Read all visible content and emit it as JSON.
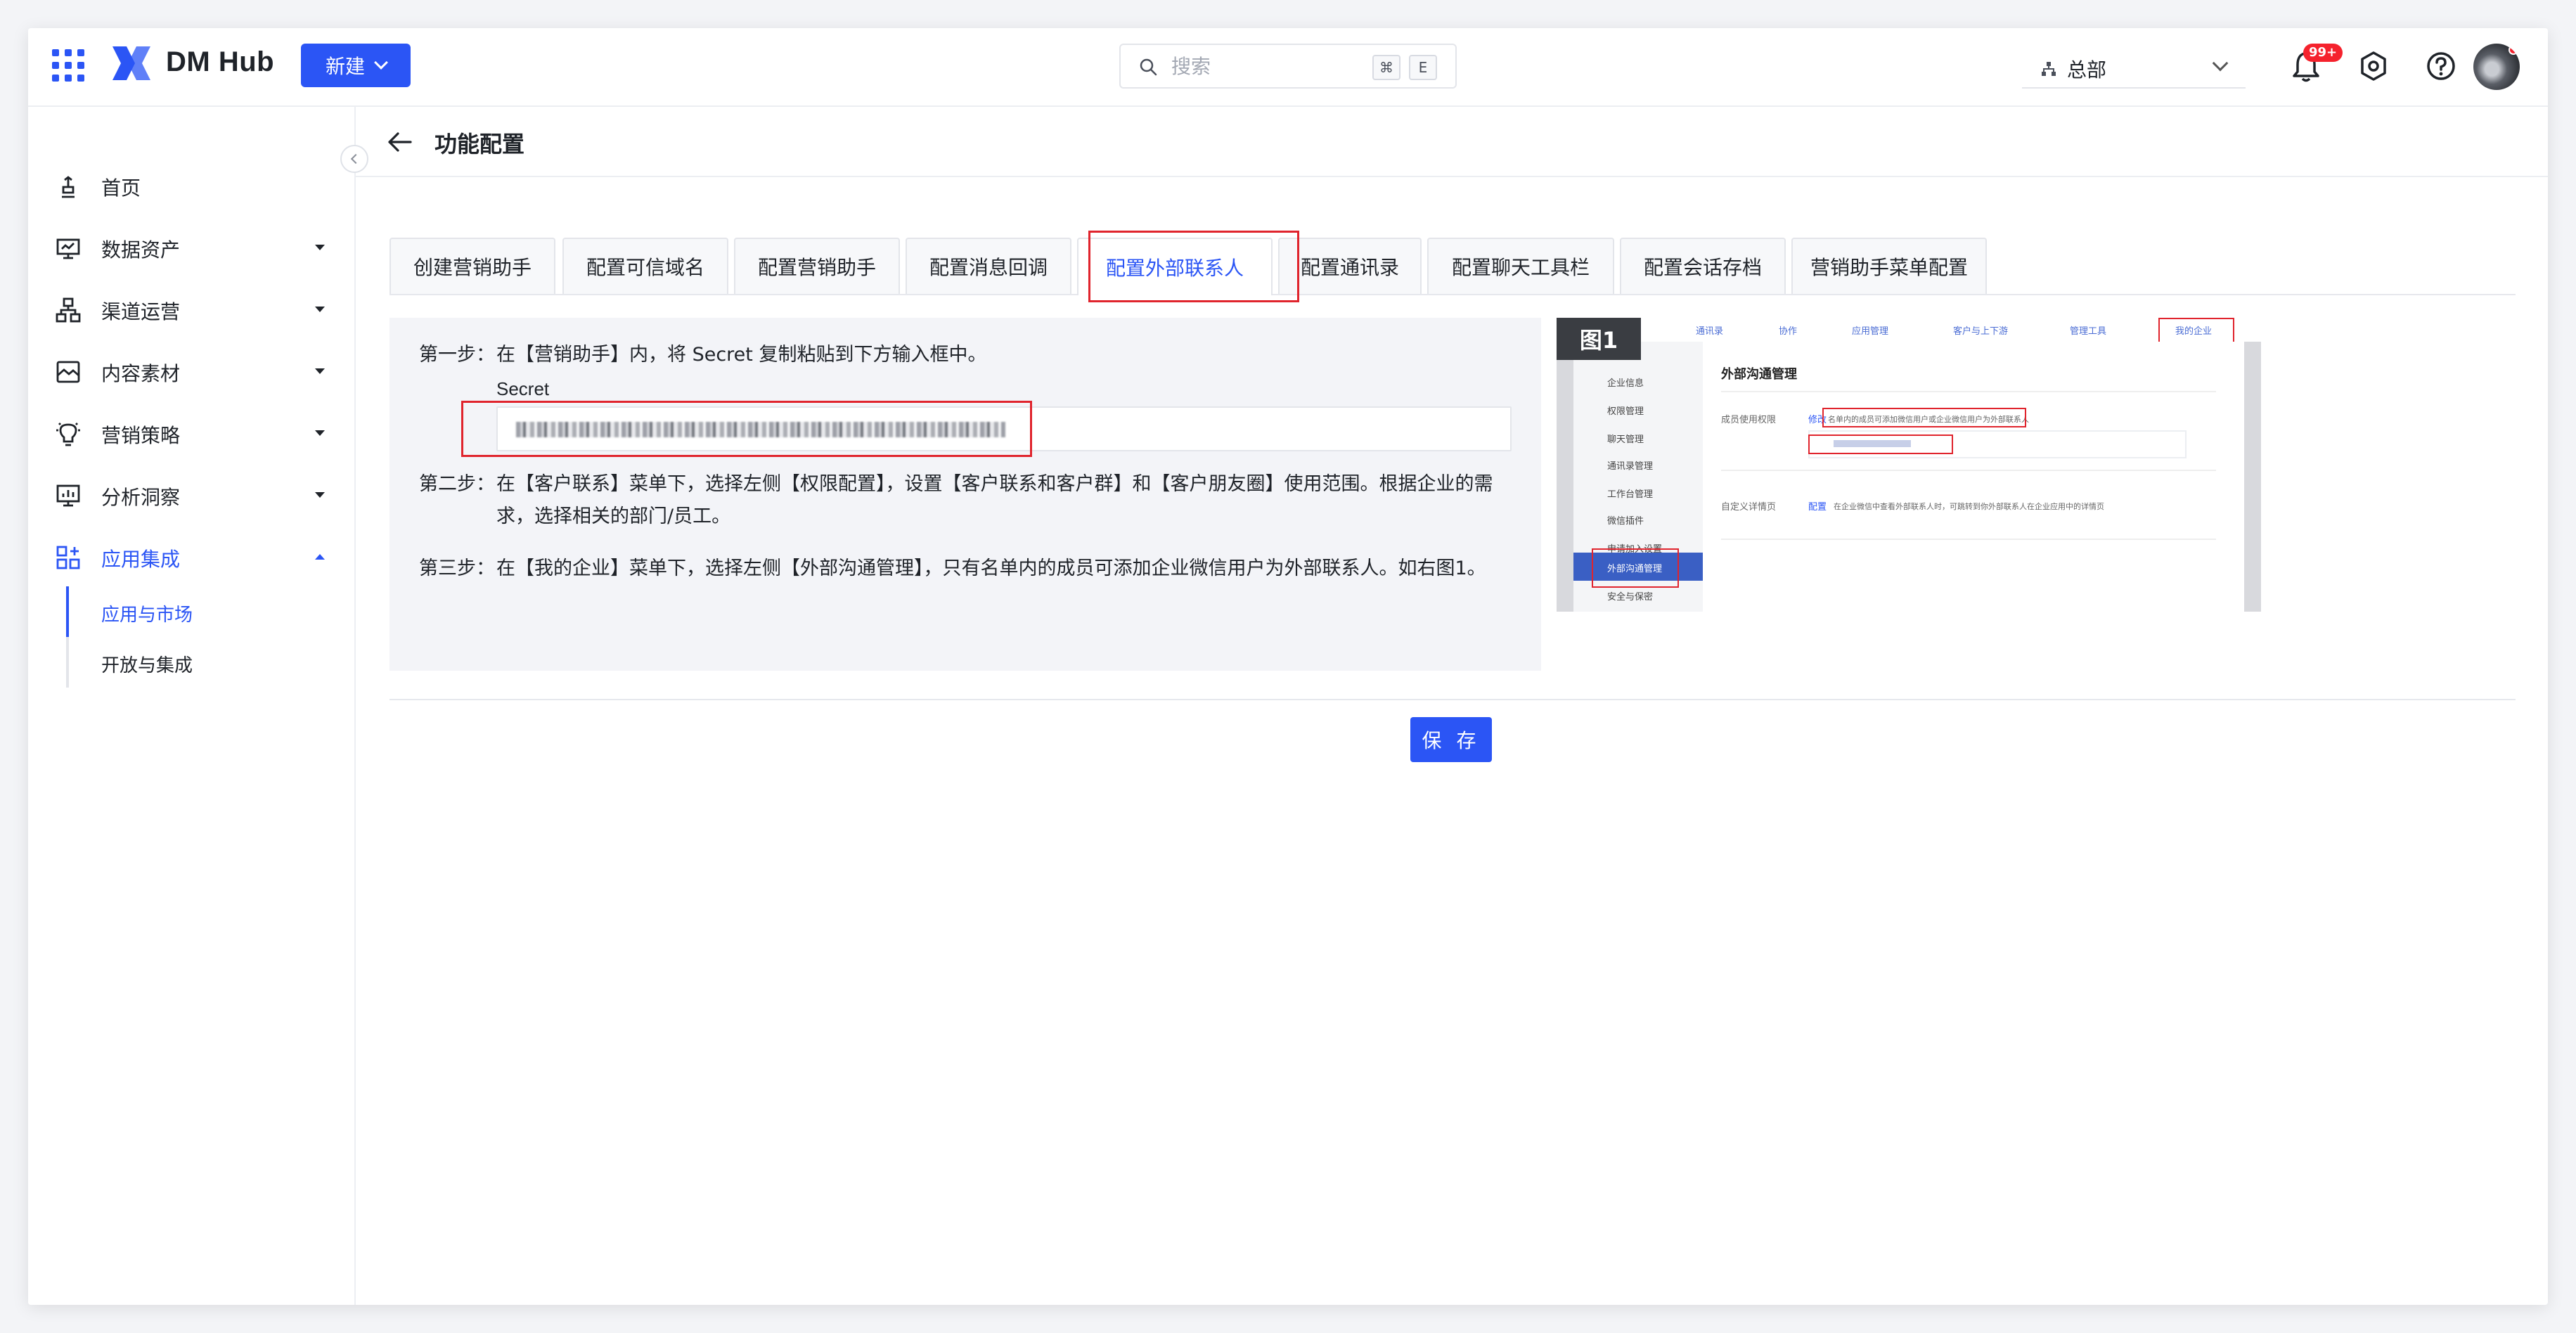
{
  "app": {
    "brand": "DM Hub",
    "new_button": "新建",
    "search": {
      "placeholder": "搜索",
      "shortcut_key1": "⌘",
      "shortcut_key2": "E"
    },
    "org_selector": "总部",
    "notifications_badge": "99+",
    "accent_color": "#2b55f5",
    "highlight_color": "#e0242d"
  },
  "sidebar": {
    "items": [
      {
        "label": "首页",
        "icon": "home-icon"
      },
      {
        "label": "数据资产",
        "icon": "data-assets-icon"
      },
      {
        "label": "渠道运营",
        "icon": "channel-icon"
      },
      {
        "label": "内容素材",
        "icon": "content-icon"
      },
      {
        "label": "营销策略",
        "icon": "strategy-icon"
      },
      {
        "label": "分析洞察",
        "icon": "analytics-icon"
      },
      {
        "label": "应用集成",
        "icon": "integration-icon"
      }
    ],
    "sub_items": [
      {
        "label": "应用与市场"
      },
      {
        "label": "开放与集成"
      }
    ]
  },
  "page": {
    "title": "功能配置",
    "tabs": [
      "创建营销助手",
      "配置可信域名",
      "配置营销助手",
      "配置消息回调",
      "配置外部联系人",
      "配置通讯录",
      "配置聊天工具栏",
      "配置会话存档",
      "营销助手菜单配置"
    ],
    "active_tab": "配置外部联系人",
    "steps": [
      {
        "label": "第一步：",
        "text": "在【营销助手】内，将 Secret 复制粘贴到下方输入框中。"
      },
      {
        "label": "第二步：",
        "text": "在【客户联系】菜单下，选择左侧【权限配置】，设置【客户联系和客户群】和【客户朋友圈】使用范围。根据企业的需求，选择相关的部门/员工。"
      },
      {
        "label": "第三步：",
        "text": "在【我的企业】菜单下，选择左侧【外部沟通管理】，只有名单内的成员可添加企业微信用户为外部联系人。如右图1。"
      }
    ],
    "secret_label": "Secret",
    "save_button": "保 存"
  },
  "figure": {
    "label": "图1",
    "top_nav": [
      "通讯录",
      "协作",
      "应用管理",
      "客户与上下游",
      "管理工具",
      "我的企业"
    ],
    "side_nav": [
      "企业信息",
      "权限管理",
      "聊天管理",
      "通讯录管理",
      "工作台管理",
      "微信插件",
      "申请加入设置",
      "外部沟通管理",
      "安全与保密"
    ],
    "title": "外部沟通管理",
    "row1_label": "成员使用权限",
    "row1_link": "修改",
    "row1_note": "名单内的成员可添加微信用户或企业微信用户为外部联系人",
    "row2_label": "自定义详情页",
    "row2_link": "配置",
    "row2_note": "在企业微信中查看外部联系人时，可跳转到你外部联系人在企业应用中的详情页"
  }
}
